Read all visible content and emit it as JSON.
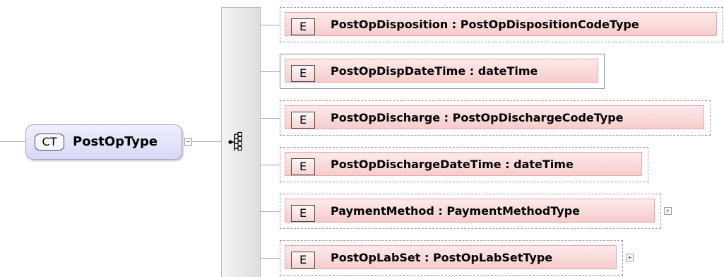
{
  "complex_type": {
    "badge": "CT",
    "name": "PostOpType"
  },
  "sequence": {
    "icon": "sequence-compositor-icon"
  },
  "elements": [
    {
      "badge": "E",
      "label": "PostOpDisposition : PostOpDispositionCodeType",
      "optional": true,
      "expandable": false
    },
    {
      "badge": "E",
      "label": "PostOpDispDateTime : dateTime",
      "optional": false,
      "expandable": false
    },
    {
      "badge": "E",
      "label": "PostOpDischarge : PostOpDischargeCodeType",
      "optional": true,
      "expandable": false
    },
    {
      "badge": "E",
      "label": "PostOpDischargeDateTime : dateTime",
      "optional": true,
      "expandable": false
    },
    {
      "badge": "E",
      "label": "PaymentMethod : PaymentMethodType",
      "optional": true,
      "expandable": true
    },
    {
      "badge": "E",
      "label": "PostOpLabSet : PostOpLabSetType",
      "optional": true,
      "expandable": true
    }
  ],
  "colors": {
    "complex_type_fill": "#d8d8f6",
    "element_fill": "#f7cccc",
    "connector": "#a8a8a8"
  }
}
